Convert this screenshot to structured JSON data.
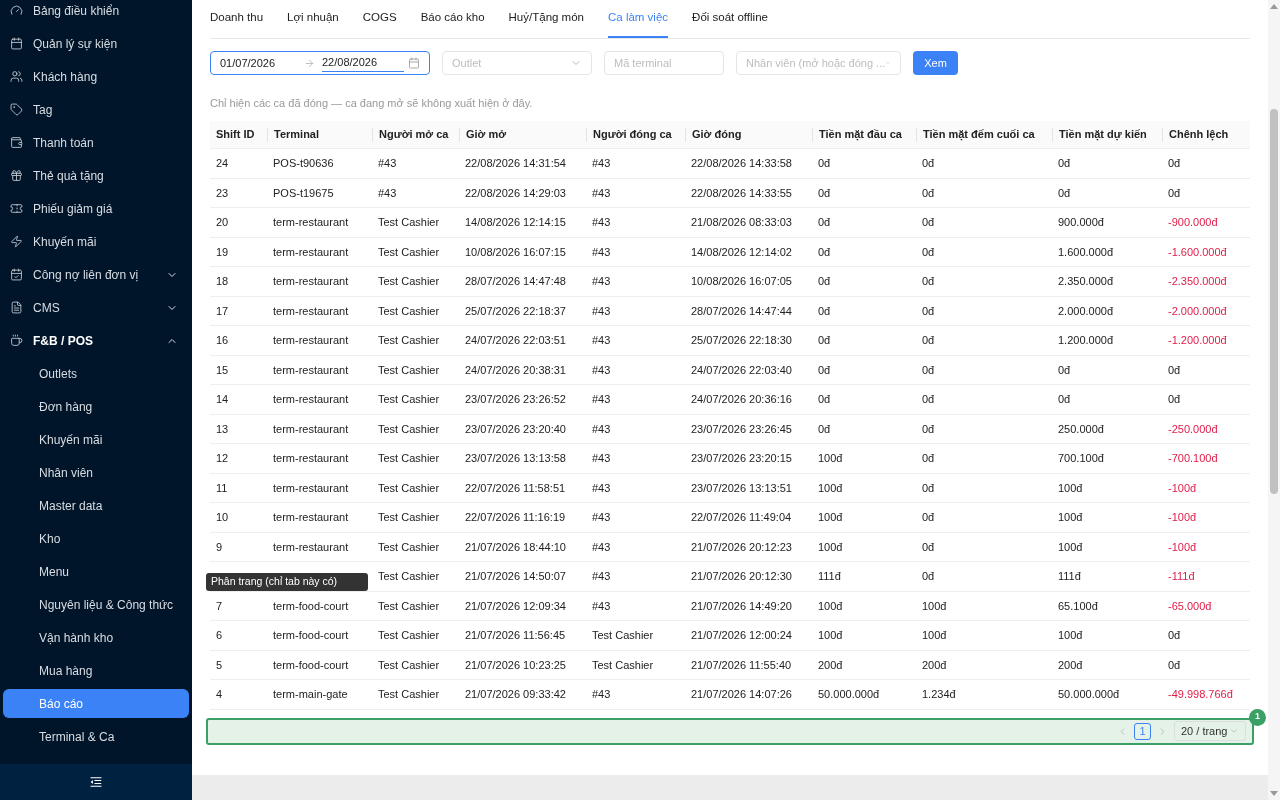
{
  "sidebar": {
    "items": [
      {
        "label": "Bảng điều khiển"
      },
      {
        "label": "Quản lý sự kiện"
      },
      {
        "label": "Khách hàng"
      },
      {
        "label": "Tag"
      },
      {
        "label": "Thanh toán"
      },
      {
        "label": "Thẻ quà tặng"
      },
      {
        "label": "Phiếu giảm giá"
      },
      {
        "label": "Khuyến mãi"
      },
      {
        "label": "Công nợ liên đơn vị",
        "expanded": false
      },
      {
        "label": "CMS",
        "expanded": false
      },
      {
        "label": "F&B / POS",
        "expanded": true,
        "children": [
          {
            "label": "Outlets",
            "selected": false
          },
          {
            "label": "Đơn hàng",
            "selected": false
          },
          {
            "label": "Khuyến mãi",
            "selected": false
          },
          {
            "label": "Nhân viên",
            "selected": false
          },
          {
            "label": "Master data",
            "selected": false
          },
          {
            "label": "Kho",
            "selected": false
          },
          {
            "label": "Menu",
            "selected": false
          },
          {
            "label": "Nguyên liệu & Công thức",
            "selected": false
          },
          {
            "label": "Vận hành kho",
            "selected": false
          },
          {
            "label": "Mua hàng",
            "selected": false
          },
          {
            "label": "Báo cáo",
            "selected": true
          },
          {
            "label": "Terminal & Ca",
            "selected": false
          }
        ]
      }
    ]
  },
  "tabs": [
    {
      "label": "Doanh thu",
      "selected": false
    },
    {
      "label": "Lợi nhuận",
      "selected": false
    },
    {
      "label": "COGS",
      "selected": false
    },
    {
      "label": "Báo cáo kho",
      "selected": false
    },
    {
      "label": "Huỷ/Tặng món",
      "selected": false
    },
    {
      "label": "Ca làm việc",
      "selected": true
    },
    {
      "label": "Đối soát offline",
      "selected": false
    }
  ],
  "filters": {
    "date_start": "01/07/2026",
    "date_end": "22/08/2026",
    "outlet": {
      "placeholder": "Outlet"
    },
    "terminal": {
      "placeholder": "Mã terminal"
    },
    "staff": {
      "placeholder": "Nhân viên (mở hoặc đóng ..."
    },
    "button": "Xem"
  },
  "note": "Chỉ hiện các ca đã đóng — ca đang mở sẽ không xuất hiện ở đây.",
  "table": {
    "columns": [
      "Shift ID",
      "Terminal",
      "Người mở ca",
      "Giờ mở",
      "Người đóng ca",
      "Giờ đóng",
      "Tiền mặt đầu ca",
      "Tiền mặt đếm cuối ca",
      "Tiền mặt dự kiến",
      "Chênh lệch"
    ],
    "rows": [
      {
        "cells": [
          "24",
          "POS-t90636",
          "#43",
          "22/08/2026 14:31:54",
          "#43",
          "22/08/2026 14:33:58",
          "0đ",
          "0đ",
          "0đ",
          "0đ"
        ],
        "diff_negative": false
      },
      {
        "cells": [
          "23",
          "POS-t19675",
          "#43",
          "22/08/2026 14:29:03",
          "#43",
          "22/08/2026 14:33:55",
          "0đ",
          "0đ",
          "0đ",
          "0đ"
        ],
        "diff_negative": false
      },
      {
        "cells": [
          "20",
          "term-restaurant",
          "Test Cashier",
          "14/08/2026 12:14:15",
          "#43",
          "21/08/2026 08:33:03",
          "0đ",
          "0đ",
          "900.000đ",
          "-900.000đ"
        ],
        "diff_negative": true
      },
      {
        "cells": [
          "19",
          "term-restaurant",
          "Test Cashier",
          "10/08/2026 16:07:15",
          "#43",
          "14/08/2026 12:14:02",
          "0đ",
          "0đ",
          "1.600.000đ",
          "-1.600.000đ"
        ],
        "diff_negative": true
      },
      {
        "cells": [
          "18",
          "term-restaurant",
          "Test Cashier",
          "28/07/2026 14:47:48",
          "#43",
          "10/08/2026 16:07:05",
          "0đ",
          "0đ",
          "2.350.000đ",
          "-2.350.000đ"
        ],
        "diff_negative": true
      },
      {
        "cells": [
          "17",
          "term-restaurant",
          "Test Cashier",
          "25/07/2026 22:18:37",
          "#43",
          "28/07/2026 14:47:44",
          "0đ",
          "0đ",
          "2.000.000đ",
          "-2.000.000đ"
        ],
        "diff_negative": true
      },
      {
        "cells": [
          "16",
          "term-restaurant",
          "Test Cashier",
          "24/07/2026 22:03:51",
          "#43",
          "25/07/2026 22:18:30",
          "0đ",
          "0đ",
          "1.200.000đ",
          "-1.200.000đ"
        ],
        "diff_negative": true
      },
      {
        "cells": [
          "15",
          "term-restaurant",
          "Test Cashier",
          "24/07/2026 20:38:31",
          "#43",
          "24/07/2026 22:03:40",
          "0đ",
          "0đ",
          "0đ",
          "0đ"
        ],
        "diff_negative": false
      },
      {
        "cells": [
          "14",
          "term-restaurant",
          "Test Cashier",
          "23/07/2026 23:26:52",
          "#43",
          "24/07/2026 20:36:16",
          "0đ",
          "0đ",
          "0đ",
          "0đ"
        ],
        "diff_negative": false
      },
      {
        "cells": [
          "13",
          "term-restaurant",
          "Test Cashier",
          "23/07/2026 23:20:40",
          "#43",
          "23/07/2026 23:26:45",
          "0đ",
          "0đ",
          "250.000đ",
          "-250.000đ"
        ],
        "diff_negative": true
      },
      {
        "cells": [
          "12",
          "term-restaurant",
          "Test Cashier",
          "23/07/2026 13:13:58",
          "#43",
          "23/07/2026 23:20:15",
          "100đ",
          "0đ",
          "700.100đ",
          "-700.100đ"
        ],
        "diff_negative": true
      },
      {
        "cells": [
          "11",
          "term-restaurant",
          "Test Cashier",
          "22/07/2026 11:58:51",
          "#43",
          "23/07/2026 13:13:51",
          "100đ",
          "0đ",
          "100đ",
          "-100đ"
        ],
        "diff_negative": true
      },
      {
        "cells": [
          "10",
          "term-restaurant",
          "Test Cashier",
          "22/07/2026 11:16:19",
          "#43",
          "22/07/2026 11:49:04",
          "100đ",
          "0đ",
          "100đ",
          "-100đ"
        ],
        "diff_negative": true
      },
      {
        "cells": [
          "9",
          "term-restaurant",
          "Test Cashier",
          "21/07/2026 18:44:10",
          "#43",
          "21/07/2026 20:12:23",
          "100đ",
          "0đ",
          "100đ",
          "-100đ"
        ],
        "diff_negative": true
      },
      {
        "cells": [
          null,
          null,
          "Test Cashier",
          "21/07/2026 14:50:07",
          "#43",
          "21/07/2026 20:12:30",
          "111đ",
          "0đ",
          "111đ",
          "-111đ"
        ],
        "diff_negative": true,
        "tooltip": "Phân trang (chỉ tab này có)"
      },
      {
        "cells": [
          "7",
          "term-food-court",
          "Test Cashier",
          "21/07/2026 12:09:34",
          "#43",
          "21/07/2026 14:49:20",
          "100đ",
          "100đ",
          "65.100đ",
          "-65.000đ"
        ],
        "diff_negative": true
      },
      {
        "cells": [
          "6",
          "term-food-court",
          "Test Cashier",
          "21/07/2026 11:56:45",
          "Test Cashier",
          "21/07/2026 12:00:24",
          "100đ",
          "100đ",
          "100đ",
          "0đ"
        ],
        "diff_negative": false
      },
      {
        "cells": [
          "5",
          "term-food-court",
          "Test Cashier",
          "21/07/2026 10:23:25",
          "Test Cashier",
          "21/07/2026 11:55:40",
          "200đ",
          "200đ",
          "200đ",
          "0đ"
        ],
        "diff_negative": false
      },
      {
        "cells": [
          "4",
          "term-main-gate",
          "Test Cashier",
          "21/07/2026 09:33:42",
          "#43",
          "21/07/2026 14:07:26",
          "50.000.000đ",
          "1.234đ",
          "50.000.000đ",
          "-49.998.766đ"
        ],
        "diff_negative": true
      }
    ]
  },
  "pagination": {
    "badge": "1",
    "page": "1",
    "page_size": "20 / trang"
  }
}
